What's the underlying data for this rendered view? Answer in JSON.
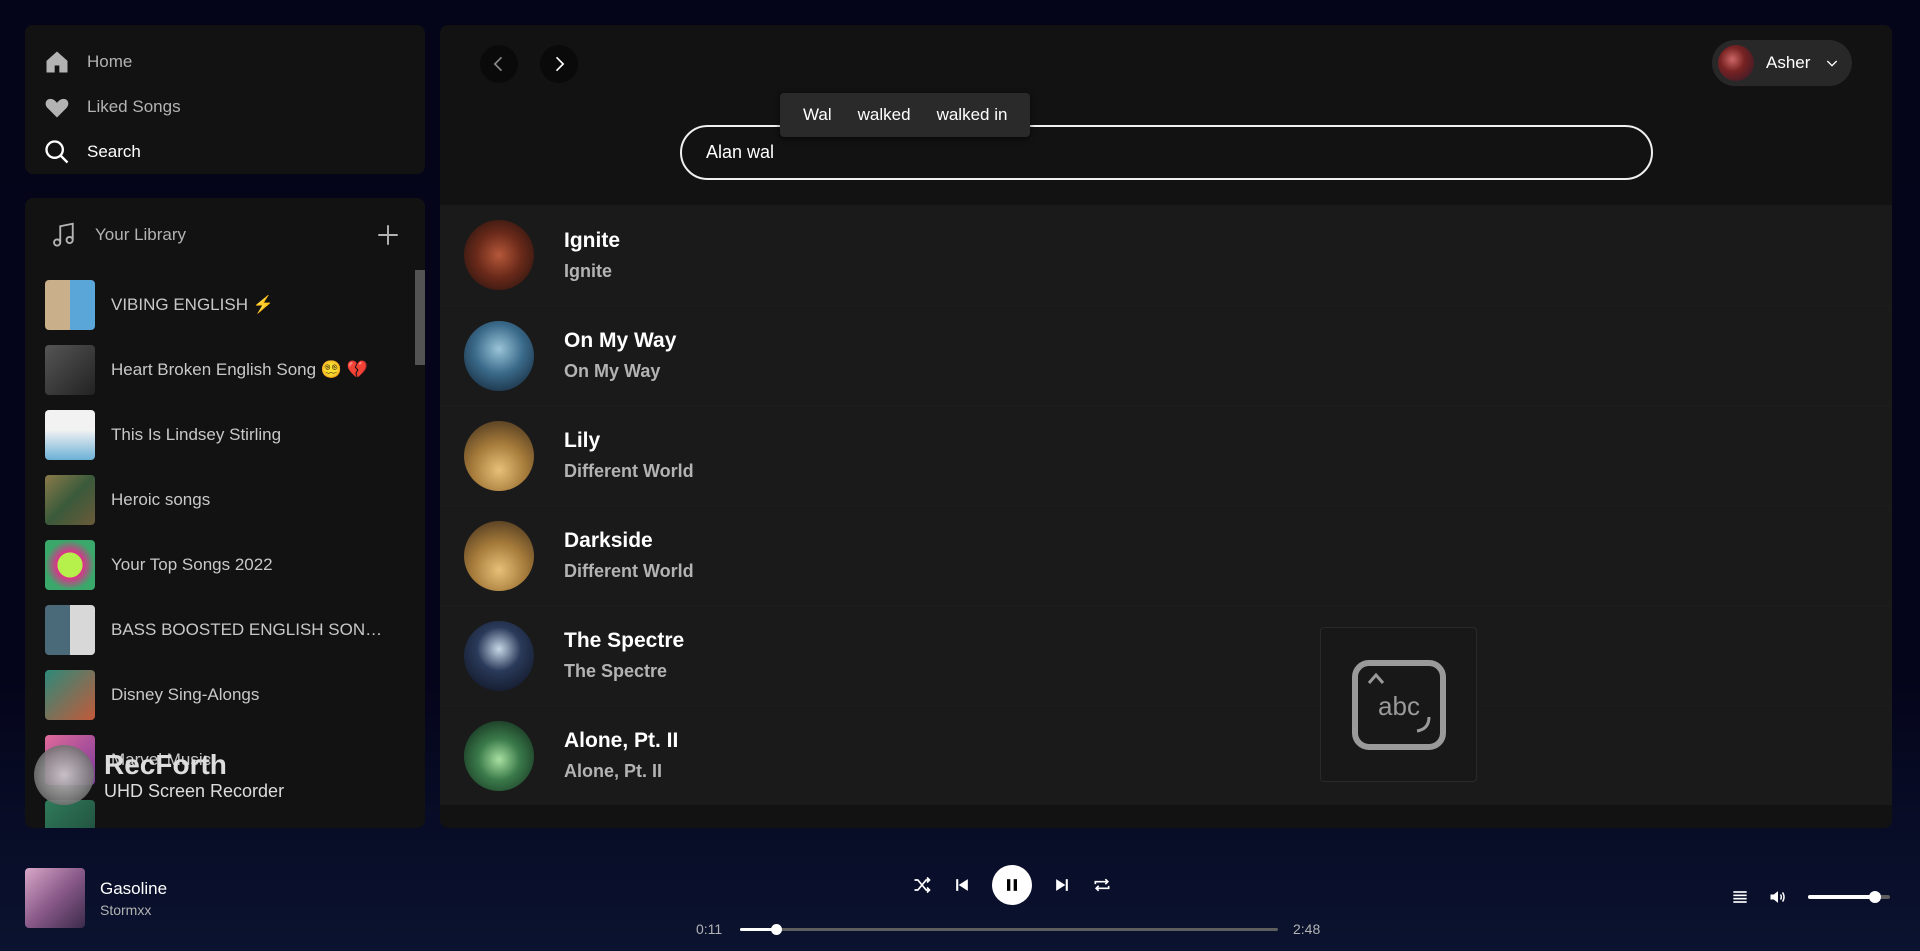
{
  "nav": {
    "items": [
      {
        "label": "Home",
        "icon": "home-icon"
      },
      {
        "label": "Liked Songs",
        "icon": "heart-icon"
      },
      {
        "label": "Search",
        "icon": "search-icon",
        "active": true
      }
    ]
  },
  "library": {
    "title": "Your Library",
    "items": [
      {
        "name": "VIBING ENGLISH ⚡"
      },
      {
        "name": "Heart Broken English Song 😵‍💫 💔"
      },
      {
        "name": "This Is Lindsey Stirling"
      },
      {
        "name": "Heroic songs"
      },
      {
        "name": "Your Top Songs 2022"
      },
      {
        "name": "BASS BOOSTED ENGLISH SONG ..."
      },
      {
        "name": "Disney Sing-Alongs"
      },
      {
        "name": "Marvel Music"
      },
      {
        "name": ""
      }
    ]
  },
  "user": {
    "name": "Asher"
  },
  "search": {
    "value": "Alan wal",
    "suggestions": [
      "Wal",
      "walked",
      "walked in"
    ]
  },
  "results": [
    {
      "title": "Ignite",
      "subtitle": "Ignite",
      "cover": "ignite"
    },
    {
      "title": "On My Way",
      "subtitle": "On My Way",
      "cover": "onmyway"
    },
    {
      "title": "Lily",
      "subtitle": "Different World",
      "cover": "world"
    },
    {
      "title": "Darkside",
      "subtitle": "Different World",
      "cover": "world"
    },
    {
      "title": "The Spectre",
      "subtitle": "The Spectre",
      "cover": "spectre"
    },
    {
      "title": "Alone, Pt. II",
      "subtitle": "Alone, Pt. II",
      "cover": "alone"
    }
  ],
  "keyboard_overlay": {
    "label": "abc"
  },
  "watermark": {
    "title": "RecForth",
    "subtitle": "UHD Screen Recorder"
  },
  "player": {
    "track": "Gasoline",
    "artist": "Stormxx",
    "elapsed": "0:11",
    "duration": "2:48",
    "progress": 0.066,
    "volume": 0.82
  },
  "colors": {
    "accent": "#ffffff",
    "panel": "#121212",
    "row": "#1a1a1a"
  }
}
